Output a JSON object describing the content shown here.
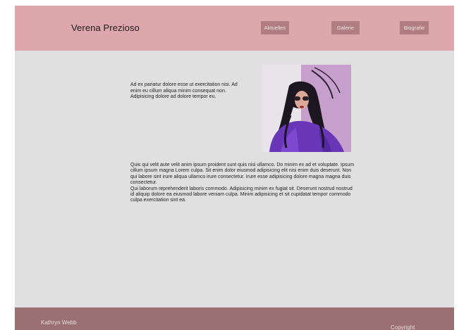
{
  "header": {
    "site_title": "Verena Prezioso",
    "nav": {
      "aktuelles": "Aktuelles",
      "galerie": "Galerie",
      "biografie": "Biografie"
    }
  },
  "main": {
    "intro": "Ad ex pariatur dolore esse ut exercitation nisi. Ad enim eu cillum aliqua minim consequat non. Adipisicing dolore ad dolore tempor eu.",
    "paragraph_1": "Quis qui velit aute velit anim ipsum proident sunt quis nisi ullamco. Do minim ex ad et voluptate. Ipsum cillum ipsum magna Lorem culpa. Sit enim dolor eiusmod adipisicing elit nisi enim duis deserunt. Non qui labore sint irure aliqua ullamco irure consectetur. Irure esse adipisicing dolore magna magna duis consectetur.",
    "paragraph_2": "Qui laborum reprehenderit laboris commodo. Adipisicing minim ex fugiat sit. Deserunt nostrud nostrud id aliquip dolore ea eiusmod labore veniam culpa. Minim adipisicing et sit cupidatat tempor commodo culpa exercitation sint ea."
  },
  "footer": {
    "author": "Kathryn Webb",
    "copyright": "Copyright"
  },
  "colors": {
    "header_bg": "#dea7ab",
    "nav_button_bg": "#b07d80",
    "page_bg": "#e0e0e0",
    "footer_bg": "#9b7073"
  }
}
